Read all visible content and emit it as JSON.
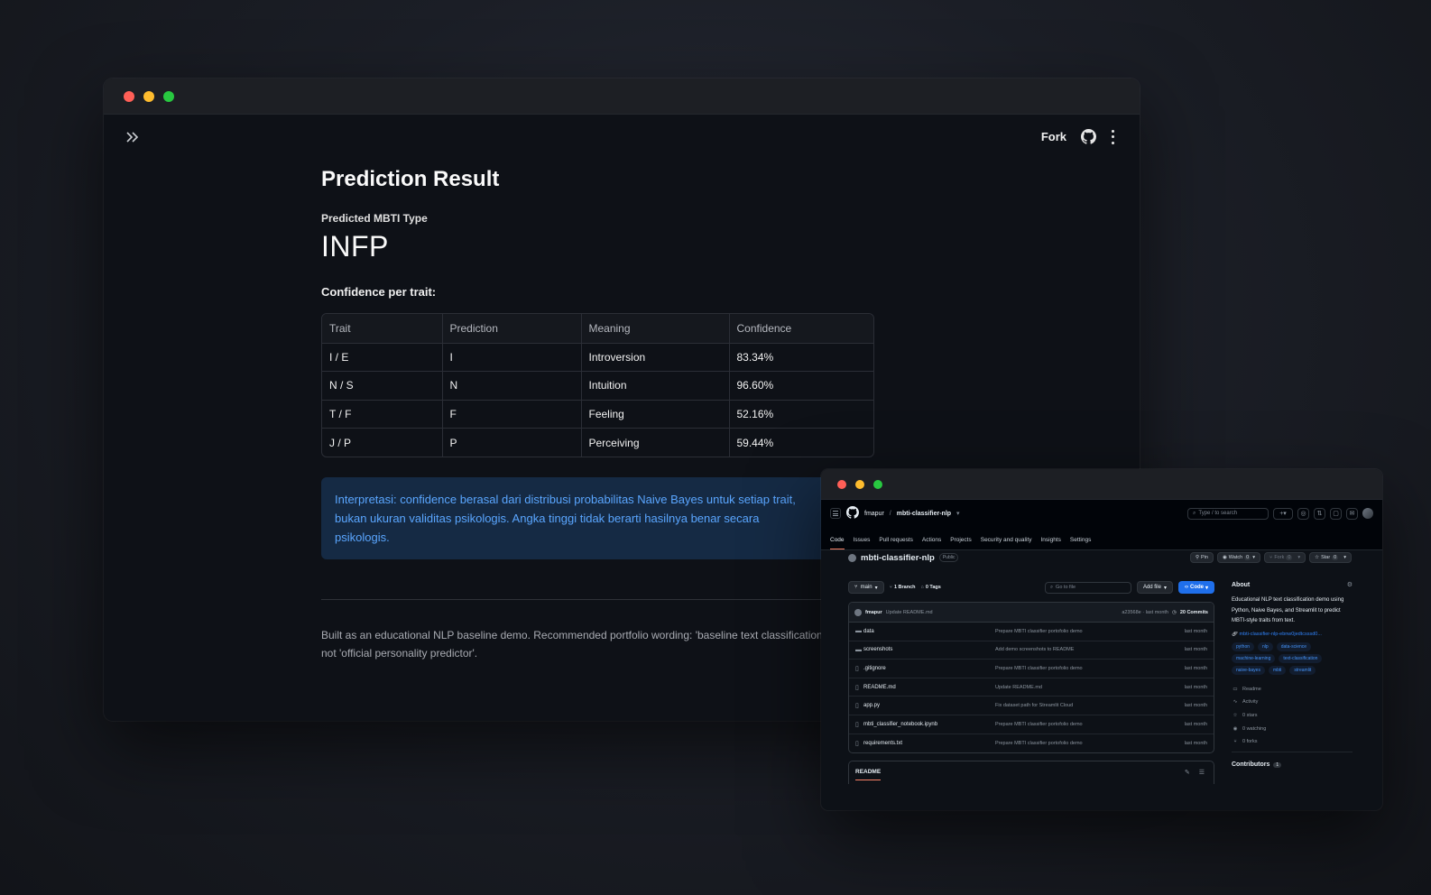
{
  "streamlit": {
    "toolbar": {
      "fork_label": "Fork"
    },
    "title": "Prediction Result",
    "metric": {
      "label": "Predicted MBTI Type",
      "value": "INFP"
    },
    "confidence_label": "Confidence per trait:",
    "table": {
      "headers": [
        "Trait",
        "Prediction",
        "Meaning",
        "Confidence"
      ],
      "rows": [
        [
          "I / E",
          "I",
          "Introversion",
          "83.34%"
        ],
        [
          "N / S",
          "N",
          "Intuition",
          "96.60%"
        ],
        [
          "T / F",
          "F",
          "Feeling",
          "52.16%"
        ],
        [
          "J / P",
          "P",
          "Perceiving",
          "59.44%"
        ]
      ]
    },
    "info_text": "Interpretasi: confidence berasal dari distribusi probabilitas Naive Bayes untuk setiap trait, bukan ukuran validitas psikologis. Angka tinggi tidak berarti hasilnya benar secara psikologis.",
    "caption": "Built as an educational NLP baseline demo. Recommended portfolio wording: 'baseline text classification not 'official personality predictor'."
  },
  "github": {
    "owner": "fmapur",
    "repo_crumb": "mbti-classifier-nlp",
    "search_placeholder": "Type / to search",
    "tabs": [
      "Code",
      "Issues",
      "Pull requests",
      "Actions",
      "Projects",
      "Security and quality",
      "Insights",
      "Settings"
    ],
    "repo_title": "mbti-classifier-nlp",
    "visibility": "Public",
    "actions": {
      "pin": "Pin",
      "watch": "Watch",
      "watch_count": "0",
      "fork": "Fork",
      "fork_count": "0",
      "star": "Star",
      "star_count": "0"
    },
    "branch": "main",
    "branches": "1 Branch",
    "tags": "0 Tags",
    "goto_placeholder": "Go to file",
    "add_file": "Add file",
    "code_button": "Code",
    "last_commit": {
      "author": "fmapur",
      "message": "Update README.md",
      "hash_time": "a23568e · last month",
      "commits": "20 Commits"
    },
    "files": [
      {
        "type": "folder",
        "name": "data",
        "message": "Prepare MBTI classifier portofolio demo",
        "time": "last month"
      },
      {
        "type": "folder",
        "name": "screenshots",
        "message": "Add demo screenshots to README",
        "time": "last month"
      },
      {
        "type": "file",
        "name": ".gitignore",
        "message": "Prepare MBTI classifier portofolio demo",
        "time": "last month"
      },
      {
        "type": "file",
        "name": "README.md",
        "message": "Update README.md",
        "time": "last month"
      },
      {
        "type": "file",
        "name": "app.py",
        "message": "Fix dataset path for Streamlit Cloud",
        "time": "last month"
      },
      {
        "type": "file",
        "name": "mbti_classifier_notebook.ipynb",
        "message": "Prepare MBTI classifier portofolio demo",
        "time": "last month"
      },
      {
        "type": "file",
        "name": "requirements.txt",
        "message": "Prepare MBTI classifier portofolio demo",
        "time": "last month"
      }
    ],
    "readme_tab": "README",
    "about": {
      "heading": "About",
      "description": "Educational NLP text classification demo using Python, Naive Bayes, and Streamlit to predict MBTI-style traits from text.",
      "link": "mbti-classifier-nlp-ebnw0jedtcsssd0...",
      "topics": [
        "python",
        "nlp",
        "data-science",
        "machine-learning",
        "text-classification",
        "naive-bayes",
        "mbti",
        "streamlit"
      ],
      "stats": [
        {
          "icon": "book-icon",
          "label": "Readme"
        },
        {
          "icon": "pulse-icon",
          "label": "Activity"
        },
        {
          "icon": "star-icon",
          "label": "0 stars"
        },
        {
          "icon": "eye-icon",
          "label": "0 watching"
        },
        {
          "icon": "fork-icon",
          "label": "0 forks"
        }
      ],
      "contributors_label": "Contributors",
      "contributors_count": "1"
    }
  },
  "colors": {
    "page_bg": "#1b1e26",
    "streamlit_bg": "#0e1117",
    "info_bg": "#152a44",
    "info_text": "#5aa6ff",
    "github_accent": "#1f6feb",
    "tab_underline": "#f78166"
  }
}
